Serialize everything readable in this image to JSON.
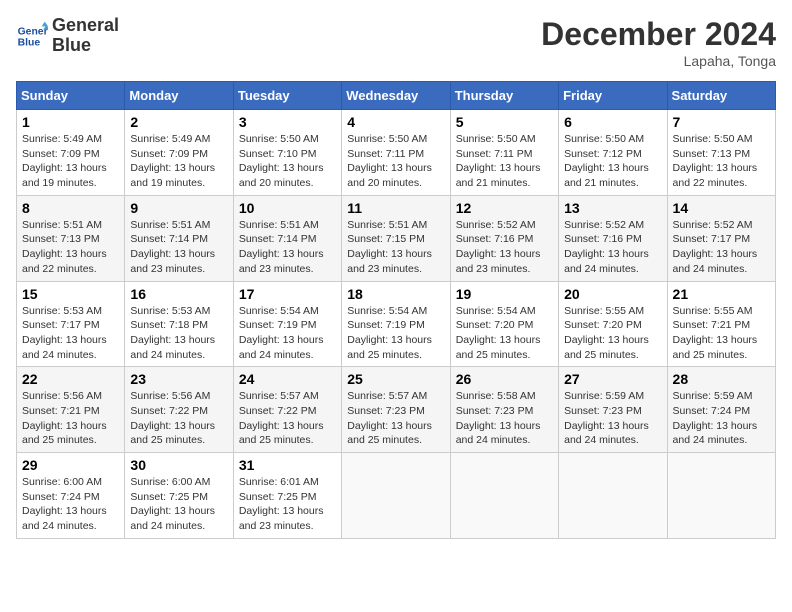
{
  "logo": {
    "line1": "General",
    "line2": "Blue"
  },
  "title": "December 2024",
  "location": "Lapaha, Tonga",
  "days_header": [
    "Sunday",
    "Monday",
    "Tuesday",
    "Wednesday",
    "Thursday",
    "Friday",
    "Saturday"
  ],
  "weeks": [
    [
      {
        "day": "1",
        "sunrise": "5:49 AM",
        "sunset": "7:09 PM",
        "daylight": "13 hours and 19 minutes."
      },
      {
        "day": "2",
        "sunrise": "5:49 AM",
        "sunset": "7:09 PM",
        "daylight": "13 hours and 19 minutes."
      },
      {
        "day": "3",
        "sunrise": "5:50 AM",
        "sunset": "7:10 PM",
        "daylight": "13 hours and 20 minutes."
      },
      {
        "day": "4",
        "sunrise": "5:50 AM",
        "sunset": "7:11 PM",
        "daylight": "13 hours and 20 minutes."
      },
      {
        "day": "5",
        "sunrise": "5:50 AM",
        "sunset": "7:11 PM",
        "daylight": "13 hours and 21 minutes."
      },
      {
        "day": "6",
        "sunrise": "5:50 AM",
        "sunset": "7:12 PM",
        "daylight": "13 hours and 21 minutes."
      },
      {
        "day": "7",
        "sunrise": "5:50 AM",
        "sunset": "7:13 PM",
        "daylight": "13 hours and 22 minutes."
      }
    ],
    [
      {
        "day": "8",
        "sunrise": "5:51 AM",
        "sunset": "7:13 PM",
        "daylight": "13 hours and 22 minutes."
      },
      {
        "day": "9",
        "sunrise": "5:51 AM",
        "sunset": "7:14 PM",
        "daylight": "13 hours and 23 minutes."
      },
      {
        "day": "10",
        "sunrise": "5:51 AM",
        "sunset": "7:14 PM",
        "daylight": "13 hours and 23 minutes."
      },
      {
        "day": "11",
        "sunrise": "5:51 AM",
        "sunset": "7:15 PM",
        "daylight": "13 hours and 23 minutes."
      },
      {
        "day": "12",
        "sunrise": "5:52 AM",
        "sunset": "7:16 PM",
        "daylight": "13 hours and 23 minutes."
      },
      {
        "day": "13",
        "sunrise": "5:52 AM",
        "sunset": "7:16 PM",
        "daylight": "13 hours and 24 minutes."
      },
      {
        "day": "14",
        "sunrise": "5:52 AM",
        "sunset": "7:17 PM",
        "daylight": "13 hours and 24 minutes."
      }
    ],
    [
      {
        "day": "15",
        "sunrise": "5:53 AM",
        "sunset": "7:17 PM",
        "daylight": "13 hours and 24 minutes."
      },
      {
        "day": "16",
        "sunrise": "5:53 AM",
        "sunset": "7:18 PM",
        "daylight": "13 hours and 24 minutes."
      },
      {
        "day": "17",
        "sunrise": "5:54 AM",
        "sunset": "7:19 PM",
        "daylight": "13 hours and 24 minutes."
      },
      {
        "day": "18",
        "sunrise": "5:54 AM",
        "sunset": "7:19 PM",
        "daylight": "13 hours and 25 minutes."
      },
      {
        "day": "19",
        "sunrise": "5:54 AM",
        "sunset": "7:20 PM",
        "daylight": "13 hours and 25 minutes."
      },
      {
        "day": "20",
        "sunrise": "5:55 AM",
        "sunset": "7:20 PM",
        "daylight": "13 hours and 25 minutes."
      },
      {
        "day": "21",
        "sunrise": "5:55 AM",
        "sunset": "7:21 PM",
        "daylight": "13 hours and 25 minutes."
      }
    ],
    [
      {
        "day": "22",
        "sunrise": "5:56 AM",
        "sunset": "7:21 PM",
        "daylight": "13 hours and 25 minutes."
      },
      {
        "day": "23",
        "sunrise": "5:56 AM",
        "sunset": "7:22 PM",
        "daylight": "13 hours and 25 minutes."
      },
      {
        "day": "24",
        "sunrise": "5:57 AM",
        "sunset": "7:22 PM",
        "daylight": "13 hours and 25 minutes."
      },
      {
        "day": "25",
        "sunrise": "5:57 AM",
        "sunset": "7:23 PM",
        "daylight": "13 hours and 25 minutes."
      },
      {
        "day": "26",
        "sunrise": "5:58 AM",
        "sunset": "7:23 PM",
        "daylight": "13 hours and 24 minutes."
      },
      {
        "day": "27",
        "sunrise": "5:59 AM",
        "sunset": "7:23 PM",
        "daylight": "13 hours and 24 minutes."
      },
      {
        "day": "28",
        "sunrise": "5:59 AM",
        "sunset": "7:24 PM",
        "daylight": "13 hours and 24 minutes."
      }
    ],
    [
      {
        "day": "29",
        "sunrise": "6:00 AM",
        "sunset": "7:24 PM",
        "daylight": "13 hours and 24 minutes."
      },
      {
        "day": "30",
        "sunrise": "6:00 AM",
        "sunset": "7:25 PM",
        "daylight": "13 hours and 24 minutes."
      },
      {
        "day": "31",
        "sunrise": "6:01 AM",
        "sunset": "7:25 PM",
        "daylight": "13 hours and 23 minutes."
      },
      null,
      null,
      null,
      null
    ]
  ]
}
